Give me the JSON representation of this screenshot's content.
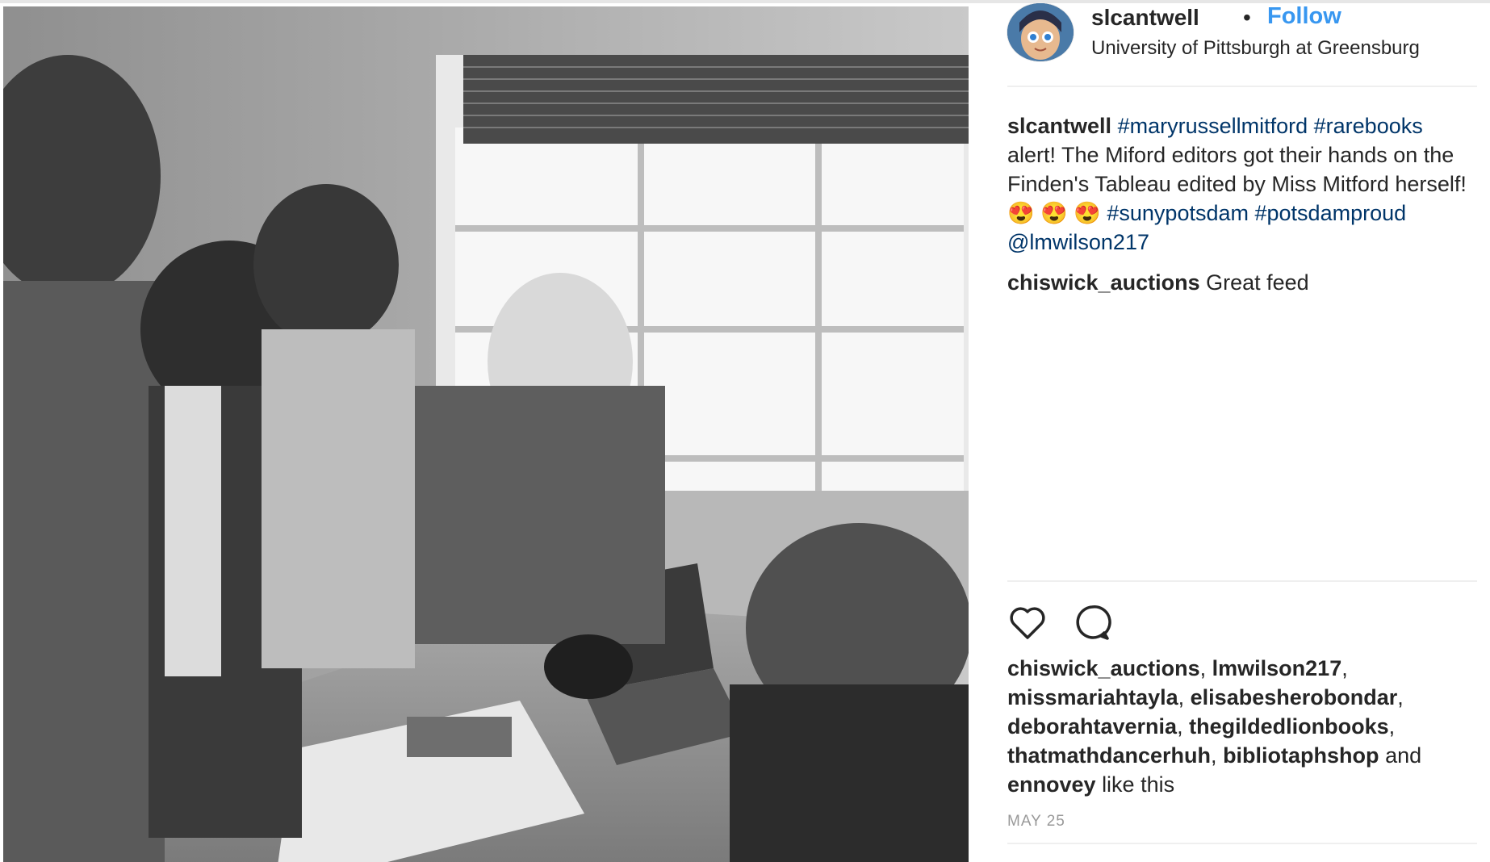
{
  "post": {
    "username": "slcantwell",
    "separator": "•",
    "follow_label": "Follow",
    "location": "University of Pittsburgh at Greensburg",
    "photo_icon": "black-and-white-photo-people-around-table"
  },
  "caption": {
    "author": "slcantwell",
    "tag_1": "#maryrussellmitford",
    "tag_2": "#rarebooks",
    "text_1": "alert! The Miford editors got their hands on the Finden's Tableau edited by Miss Mitford herself!",
    "emoji": "😍 😍 😍",
    "tag_3": "#sunypotsdam",
    "tag_4": "#potsdamproud",
    "mention": "@lmwilson217"
  },
  "comments": [
    {
      "author": "chiswick_auctions",
      "text": "Great feed"
    }
  ],
  "actions": {
    "like_icon": "heart-outline-icon",
    "comment_icon": "speech-bubble-icon"
  },
  "likes": {
    "users": [
      "chiswick_auctions",
      "lmwilson217",
      "missmariahtayla",
      "elisabesherobondar",
      "deborahtavernia",
      "thegildedlionbooks",
      "thatmathdancerhuh",
      "bibliotaphshop"
    ],
    "conjunction": "and",
    "last_user": "ennovey",
    "suffix": "like this",
    "separator": ","
  },
  "date": "MAY 25",
  "colors": {
    "link": "#3897f0",
    "hashtag": "#003569",
    "muted": "#999999",
    "text": "#262626"
  }
}
